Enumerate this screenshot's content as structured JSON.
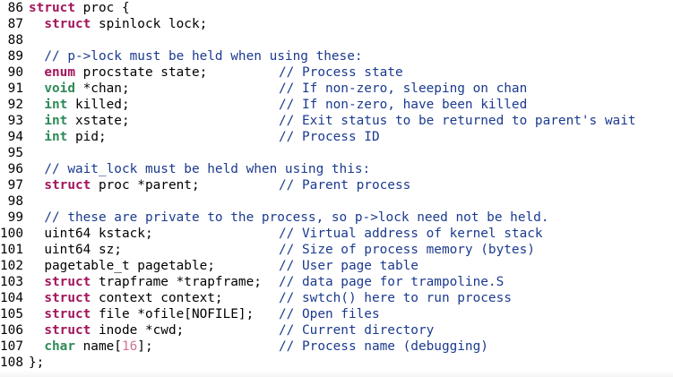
{
  "editor": {
    "lines": [
      {
        "n": "86",
        "segs": [
          [
            "kw",
            "struct"
          ],
          [
            "plain",
            " proc {"
          ]
        ]
      },
      {
        "n": "87",
        "segs": [
          [
            "plain",
            "  "
          ],
          [
            "kw",
            "struct"
          ],
          [
            "plain",
            " spinlock lock;"
          ]
        ]
      },
      {
        "n": "88",
        "segs": []
      },
      {
        "n": "89",
        "segs": [
          [
            "plain",
            "  "
          ],
          [
            "cm",
            "// p->lock must be held when using these:"
          ]
        ]
      },
      {
        "n": "90",
        "segs": [
          [
            "plain",
            "  "
          ],
          [
            "kw",
            "enum"
          ],
          [
            "plain",
            " procstate state;"
          ]
        ],
        "comment": "// Process state"
      },
      {
        "n": "91",
        "segs": [
          [
            "plain",
            "  "
          ],
          [
            "kw2",
            "void"
          ],
          [
            "plain",
            " *chan;"
          ]
        ],
        "comment": "// If non-zero, sleeping on chan"
      },
      {
        "n": "92",
        "segs": [
          [
            "plain",
            "  "
          ],
          [
            "kw2",
            "int"
          ],
          [
            "plain",
            " killed;"
          ]
        ],
        "comment": "// If non-zero, have been killed"
      },
      {
        "n": "93",
        "segs": [
          [
            "plain",
            "  "
          ],
          [
            "kw2",
            "int"
          ],
          [
            "plain",
            " xstate;"
          ]
        ],
        "comment": "// Exit status to be returned to parent's wait"
      },
      {
        "n": "94",
        "segs": [
          [
            "plain",
            "  "
          ],
          [
            "kw2",
            "int"
          ],
          [
            "plain",
            " pid;"
          ]
        ],
        "comment": "// Process ID"
      },
      {
        "n": "95",
        "segs": []
      },
      {
        "n": "96",
        "segs": [
          [
            "plain",
            "  "
          ],
          [
            "cm",
            "// wait_lock must be held when using this:"
          ]
        ]
      },
      {
        "n": "97",
        "segs": [
          [
            "plain",
            "  "
          ],
          [
            "kw",
            "struct"
          ],
          [
            "plain",
            " proc *parent;"
          ]
        ],
        "comment": "// Parent process"
      },
      {
        "n": "98",
        "segs": []
      },
      {
        "n": "99",
        "segs": [
          [
            "plain",
            "  "
          ],
          [
            "cm",
            "// these are private to the process, so p->lock need not be held."
          ]
        ]
      },
      {
        "n": "100",
        "segs": [
          [
            "plain",
            "  uint64 kstack;"
          ]
        ],
        "comment": "// Virtual address of kernel stack"
      },
      {
        "n": "101",
        "segs": [
          [
            "plain",
            "  uint64 sz;"
          ]
        ],
        "comment": "// Size of process memory (bytes)"
      },
      {
        "n": "102",
        "segs": [
          [
            "plain",
            "  pagetable_t pagetable;"
          ]
        ],
        "comment": "// User page table"
      },
      {
        "n": "103",
        "segs": [
          [
            "plain",
            "  "
          ],
          [
            "kw",
            "struct"
          ],
          [
            "plain",
            " trapframe *trapframe;"
          ]
        ],
        "comment": "// data page for trampoline.S"
      },
      {
        "n": "104",
        "segs": [
          [
            "plain",
            "  "
          ],
          [
            "kw",
            "struct"
          ],
          [
            "plain",
            " context context;"
          ]
        ],
        "comment": "// swtch() here to run process"
      },
      {
        "n": "105",
        "segs": [
          [
            "plain",
            "  "
          ],
          [
            "kw",
            "struct"
          ],
          [
            "plain",
            " file *ofile[NOFILE];"
          ]
        ],
        "comment": "// Open files"
      },
      {
        "n": "106",
        "segs": [
          [
            "plain",
            "  "
          ],
          [
            "kw",
            "struct"
          ],
          [
            "plain",
            " inode *cwd;"
          ]
        ],
        "comment": "// Current directory"
      },
      {
        "n": "107",
        "segs": [
          [
            "plain",
            "  "
          ],
          [
            "kw2",
            "char"
          ],
          [
            "plain",
            " name["
          ],
          [
            "num",
            "16"
          ],
          [
            "plain",
            "];"
          ]
        ],
        "comment": "// Process name (debugging)"
      },
      {
        "n": "108",
        "segs": [
          [
            "plain",
            "};"
          ]
        ]
      }
    ]
  },
  "colors": {
    "background": "#ffffff",
    "keyword_struct": "#a3145a",
    "keyword_type": "#2e8b57",
    "comment": "#1b3a8f",
    "number": "#d17393",
    "text": "#000000"
  }
}
